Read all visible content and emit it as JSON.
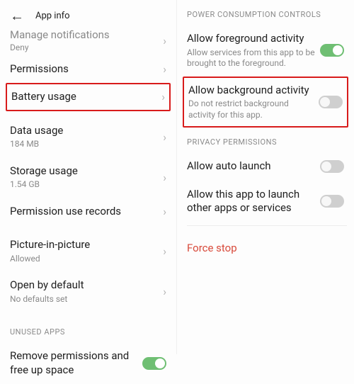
{
  "left": {
    "header_title": "App info",
    "manage_notifications": "Manage notifications",
    "deny_label": "Deny",
    "permissions": "Permissions",
    "battery_usage": "Battery usage",
    "data_usage": "Data usage",
    "data_usage_sub": "184 MB",
    "storage_usage": "Storage usage",
    "storage_usage_sub": "1.54 GB",
    "permission_records": "Permission use records",
    "pip": "Picture-in-picture",
    "pip_sub": "Allowed",
    "open_default": "Open by default",
    "open_default_sub": "No defaults set",
    "unused_apps_header": "UNUSED APPS",
    "remove_perms": "Remove permissions and free up space"
  },
  "right": {
    "power_header": "POWER CONSUMPTION CONTROLS",
    "fg_title": "Allow foreground activity",
    "fg_sub": "Allow services from this app to be brought to the foreground.",
    "bg_title": "Allow background activity",
    "bg_sub": "Do not restrict background activity for this app.",
    "privacy_header": "PRIVACY PERMISSIONS",
    "auto_launch": "Allow auto launch",
    "launch_other": "Allow this app to launch other apps or services",
    "force_stop": "Force stop"
  }
}
